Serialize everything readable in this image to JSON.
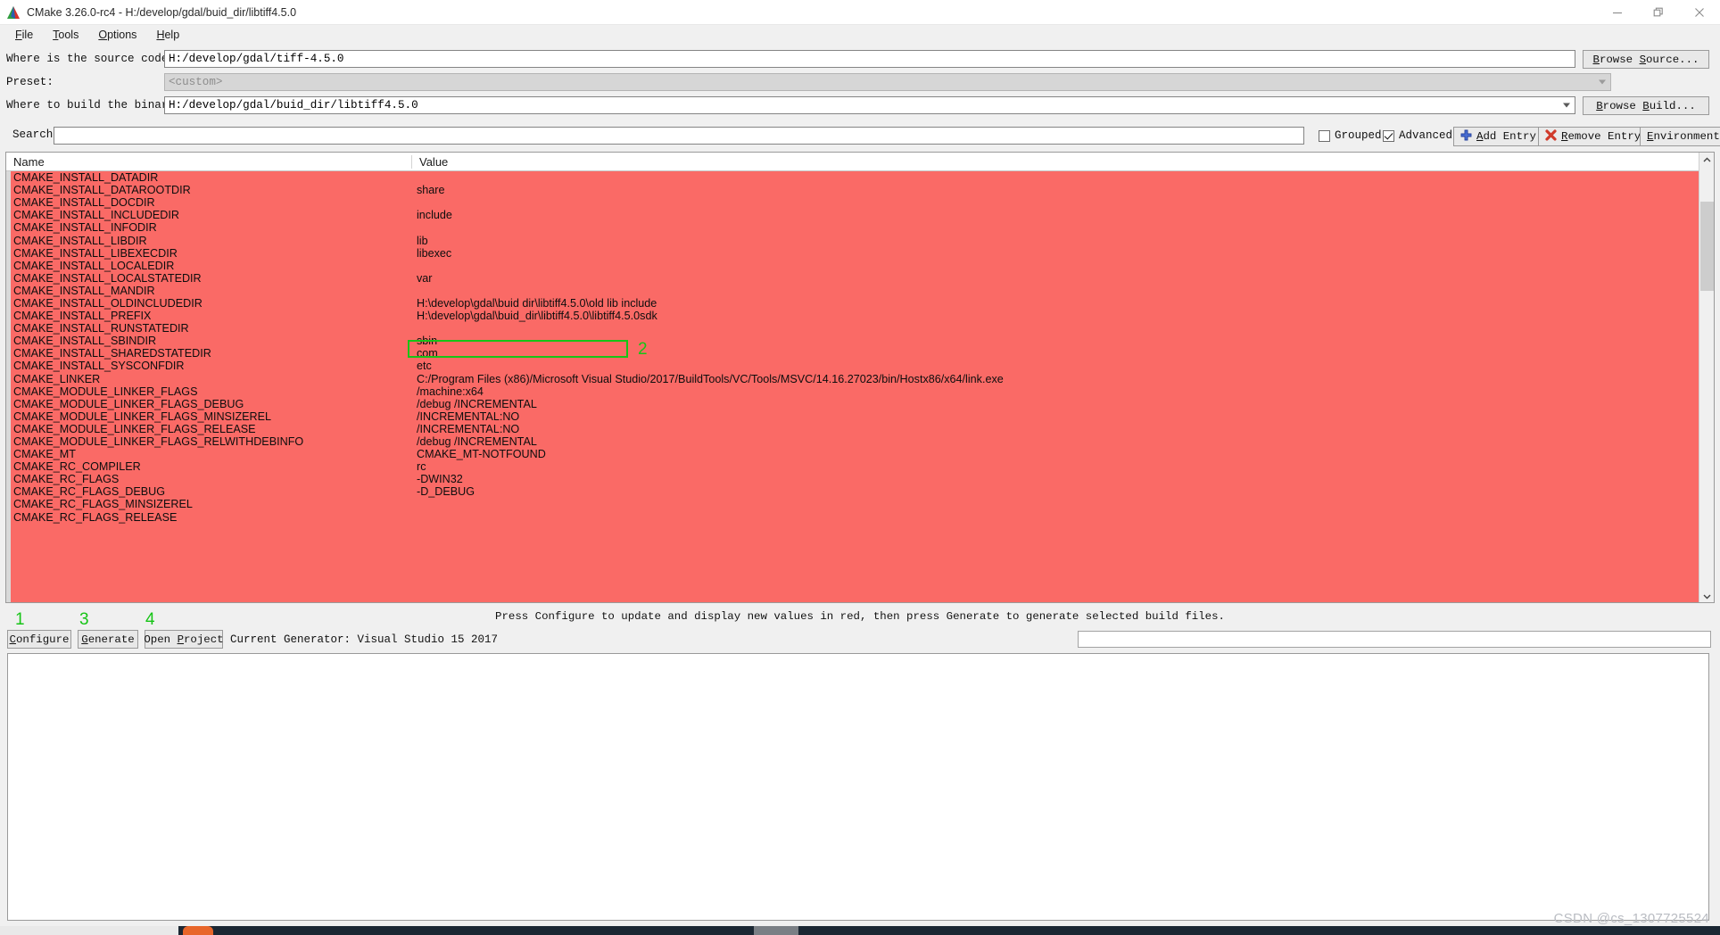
{
  "window": {
    "title": "CMake 3.26.0-rc4 - H:/develop/gdal/buid_dir/libtiff4.5.0",
    "app_icon": "cmake-triangle-icon",
    "minimize_label": "minimize-icon",
    "restore_label": "restore-icon",
    "close_label": "close-icon"
  },
  "menu": {
    "items": [
      {
        "label": "File",
        "mnemonic": "F"
      },
      {
        "label": "Tools",
        "mnemonic": "T"
      },
      {
        "label": "Options",
        "mnemonic": "O"
      },
      {
        "label": "Help",
        "mnemonic": "H"
      }
    ]
  },
  "form": {
    "source_label": "Where is the source code:",
    "source_value": "H:/develop/gdal/tiff-4.5.0",
    "browse_source_label": "Browse Source...",
    "browse_source_mnemonic": "S",
    "preset_label": "Preset:",
    "preset_value": "<custom>",
    "build_label": "Where to build the binaries:",
    "build_value": "H:/develop/gdal/buid_dir/libtiff4.5.0",
    "browse_build_label": "Browse Build...",
    "browse_build_mnemonic": "B"
  },
  "search": {
    "label": "Search:",
    "value": "",
    "placeholder": "",
    "grouped_label": "Grouped",
    "grouped_checked": false,
    "advanced_label": "Advanced",
    "advanced_checked": true,
    "add_entry_label": "Add Entry",
    "add_entry_mnemonic": "A",
    "add_entry_icon": "plus-icon",
    "remove_entry_label": "Remove Entry",
    "remove_entry_mnemonic": "R",
    "remove_entry_icon": "red-x-icon",
    "environment_label": "Environment...",
    "environment_mnemonic": "E"
  },
  "table": {
    "columns": [
      "Name",
      "Value"
    ],
    "row_highlight_color": "#fa6a66",
    "rows": [
      {
        "name": "CMAKE_INSTALL_DATADIR",
        "value": ""
      },
      {
        "name": "CMAKE_INSTALL_DATAROOTDIR",
        "value": "share"
      },
      {
        "name": "CMAKE_INSTALL_DOCDIR",
        "value": ""
      },
      {
        "name": "CMAKE_INSTALL_INCLUDEDIR",
        "value": "include"
      },
      {
        "name": "CMAKE_INSTALL_INFODIR",
        "value": ""
      },
      {
        "name": "CMAKE_INSTALL_LIBDIR",
        "value": "lib"
      },
      {
        "name": "CMAKE_INSTALL_LIBEXECDIR",
        "value": "libexec"
      },
      {
        "name": "CMAKE_INSTALL_LOCALEDIR",
        "value": ""
      },
      {
        "name": "CMAKE_INSTALL_LOCALSTATEDIR",
        "value": "var"
      },
      {
        "name": "CMAKE_INSTALL_MANDIR",
        "value": ""
      },
      {
        "name": "CMAKE_INSTALL_OLDINCLUDEDIR",
        "value": "H:\\develop\\gdal\\buid dir\\libtiff4.5.0\\old lib include"
      },
      {
        "name": "CMAKE_INSTALL_PREFIX",
        "value": "H:\\develop\\gdal\\buid_dir\\libtiff4.5.0\\libtiff4.5.0sdk"
      },
      {
        "name": "CMAKE_INSTALL_RUNSTATEDIR",
        "value": ""
      },
      {
        "name": "CMAKE_INSTALL_SBINDIR",
        "value": "sbin"
      },
      {
        "name": "CMAKE_INSTALL_SHAREDSTATEDIR",
        "value": "com"
      },
      {
        "name": "CMAKE_INSTALL_SYSCONFDIR",
        "value": "etc"
      },
      {
        "name": "CMAKE_LINKER",
        "value": "C:/Program Files (x86)/Microsoft Visual Studio/2017/BuildTools/VC/Tools/MSVC/14.16.27023/bin/Hostx86/x64/link.exe"
      },
      {
        "name": "CMAKE_MODULE_LINKER_FLAGS",
        "value": "/machine:x64"
      },
      {
        "name": "CMAKE_MODULE_LINKER_FLAGS_DEBUG",
        "value": "/debug /INCREMENTAL"
      },
      {
        "name": "CMAKE_MODULE_LINKER_FLAGS_MINSIZEREL",
        "value": "/INCREMENTAL:NO"
      },
      {
        "name": "CMAKE_MODULE_LINKER_FLAGS_RELEASE",
        "value": "/INCREMENTAL:NO"
      },
      {
        "name": "CMAKE_MODULE_LINKER_FLAGS_RELWITHDEBINFO",
        "value": "/debug /INCREMENTAL"
      },
      {
        "name": "CMAKE_MT",
        "value": "CMAKE_MT-NOTFOUND"
      },
      {
        "name": "CMAKE_RC_COMPILER",
        "value": "rc"
      },
      {
        "name": "CMAKE_RC_FLAGS",
        "value": "-DWIN32"
      },
      {
        "name": "CMAKE_RC_FLAGS_DEBUG",
        "value": "-D_DEBUG"
      },
      {
        "name": "CMAKE_RC_FLAGS_MINSIZEREL",
        "value": ""
      },
      {
        "name": "CMAKE_RC_FLAGS_RELEASE",
        "value": ""
      }
    ]
  },
  "annotations": {
    "color": "#16c416",
    "prefix_box_number": "2",
    "configure_number": "1",
    "generate_number": "3",
    "open_project_number": "4"
  },
  "status": {
    "message": "Press Configure to update and display new values in red, then press Generate to generate selected build files."
  },
  "actions": {
    "configure_label": "Configure",
    "configure_mnemonic": "C",
    "generate_label": "Generate",
    "generate_mnemonic": "G",
    "open_project_label": "Open Project",
    "open_project_mnemonic": "P",
    "current_generator": "Current Generator: Visual Studio 15 2017"
  },
  "watermark": {
    "text": "CSDN @cs_1307725524"
  }
}
